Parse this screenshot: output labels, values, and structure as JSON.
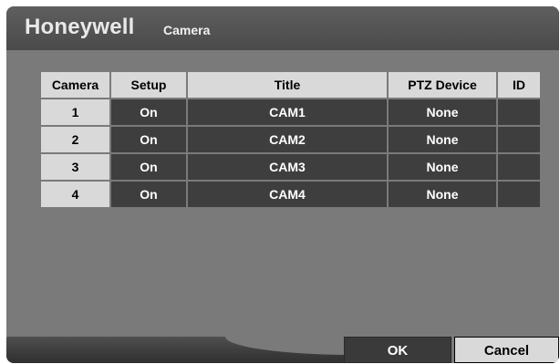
{
  "header": {
    "brand": "Honeywell",
    "title": "Camera"
  },
  "table": {
    "columns": [
      "Camera",
      "Setup",
      "Title",
      "PTZ Device",
      "ID"
    ],
    "rows": [
      {
        "camera": "1",
        "setup": "On",
        "title": "CAM1",
        "ptz": "None",
        "id": ""
      },
      {
        "camera": "2",
        "setup": "On",
        "title": "CAM2",
        "ptz": "None",
        "id": ""
      },
      {
        "camera": "3",
        "setup": "On",
        "title": "CAM3",
        "ptz": "None",
        "id": ""
      },
      {
        "camera": "4",
        "setup": "On",
        "title": "CAM4",
        "ptz": "None",
        "id": ""
      }
    ]
  },
  "buttons": {
    "ok": "OK",
    "cancel": "Cancel"
  },
  "colors": {
    "window_bg": "#7a7a7a",
    "header_bg": "#4a4a4a",
    "header_cell_bg": "#d9d9d9",
    "data_cell_bg": "#3e3e3e",
    "selected_button_bg": "#d9d9d9"
  }
}
